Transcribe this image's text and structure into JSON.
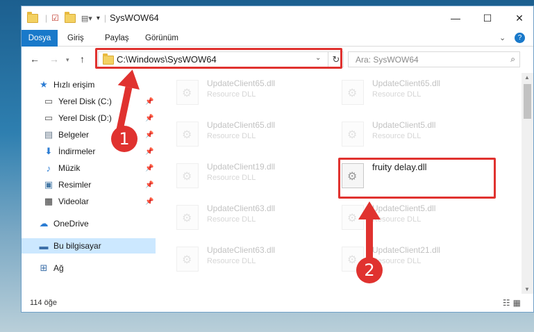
{
  "window": {
    "title": "SysWOW64"
  },
  "ribbon": {
    "tabs": [
      "Dosya",
      "Giriş",
      "Paylaş",
      "Görünüm"
    ]
  },
  "address": {
    "path": "C:\\Windows\\SysWOW64"
  },
  "search": {
    "placeholder": "Ara: SysWOW64"
  },
  "sidebar": {
    "items": [
      {
        "label": "Hızlı erişim",
        "icon": "star-icon",
        "pinned": false
      },
      {
        "label": "Yerel Disk (C:)",
        "icon": "drive-icon",
        "pinned": true
      },
      {
        "label": "Yerel Disk (D:)",
        "icon": "drive-icon",
        "pinned": true
      },
      {
        "label": "Belgeler",
        "icon": "document-icon",
        "pinned": true
      },
      {
        "label": "İndirmeler",
        "icon": "download-icon",
        "pinned": true
      },
      {
        "label": "Müzik",
        "icon": "music-icon",
        "pinned": true
      },
      {
        "label": "Resimler",
        "icon": "picture-icon",
        "pinned": true
      },
      {
        "label": "Videolar",
        "icon": "video-icon",
        "pinned": true
      },
      {
        "label": "OneDrive",
        "icon": "cloud-icon",
        "pinned": false
      },
      {
        "label": "Bu bilgisayar",
        "icon": "computer-icon",
        "pinned": false,
        "selected": true
      },
      {
        "label": "Ağ",
        "icon": "network-icon",
        "pinned": false
      }
    ]
  },
  "files": [
    {
      "name": "UpdateClient65.dll",
      "type": "Resource DLL",
      "faded": true
    },
    {
      "name": "UpdateClient65.dll",
      "type": "Resource DLL",
      "faded": true
    },
    {
      "name": "UpdateClient65.dll",
      "type": "Resource DLL",
      "faded": true
    },
    {
      "name": "UpdateClient5.dll",
      "type": "Resource DLL",
      "faded": true
    },
    {
      "name": "UpdateClient19.dll",
      "type": "Resource DLL",
      "faded": true
    },
    {
      "name": "fruity delay.dll",
      "type": "",
      "faded": false,
      "highlighted": true
    },
    {
      "name": "UpdateClient63.dll",
      "type": "Resource DLL",
      "faded": true
    },
    {
      "name": "UpdateClient5.dll",
      "type": "Resource DLL",
      "faded": true
    },
    {
      "name": "UpdateClient63.dll",
      "type": "Resource DLL",
      "faded": true
    },
    {
      "name": "UpdateClient21.dll",
      "type": "Resource DLL",
      "faded": true
    }
  ],
  "status": {
    "item_count": "114 öğe"
  },
  "annotations": {
    "step1": "1",
    "step2": "2",
    "color": "#e0322f"
  }
}
